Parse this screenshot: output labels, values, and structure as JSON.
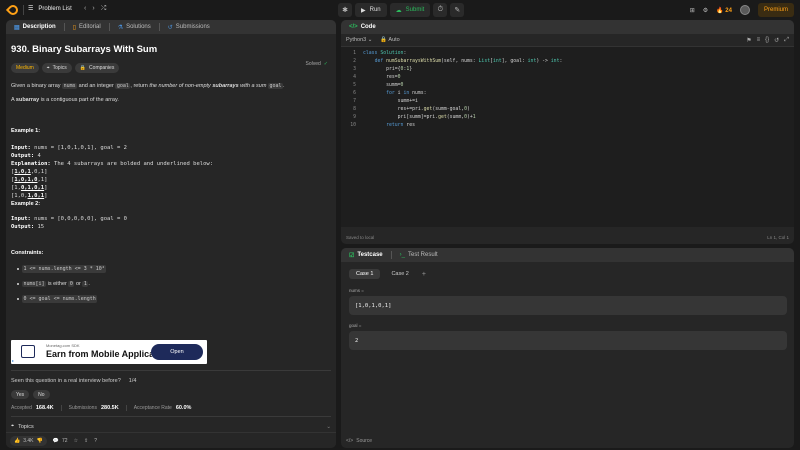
{
  "nav": {
    "problem_list": "Problem List",
    "run": "Run",
    "submit": "Submit",
    "streak": "24",
    "premium": "Premium"
  },
  "tabs": {
    "description": "Description",
    "editorial": "Editorial",
    "solutions": "Solutions",
    "submissions": "Submissions"
  },
  "problem": {
    "title": "930. Binary Subarrays With Sum",
    "solved": "Solved",
    "difficulty": "Medium",
    "topics_chip": "Topics",
    "companies_chip": "Companies",
    "stmt_a": "Given a binary array ",
    "stmt_nums": "nums",
    "stmt_b": " and an integer ",
    "stmt_goal": "goal",
    "stmt_c": ", return ",
    "stmt_d": "the number of non-empty ",
    "stmt_sub": "subarrays",
    "stmt_e": " with a sum ",
    "stmt_goal2": "goal",
    "stmt_f": ".",
    "def_a": "A ",
    "def_b": "subarray",
    "def_c": " is a contiguous part of the array.",
    "ex1_title": "Example 1:",
    "ex1_input_label": "Input:",
    "ex1_input": " nums = [1,0,1,0,1], goal = 2",
    "ex1_output_label": "Output:",
    "ex1_output": " 4",
    "ex1_expl_label": "Explanation:",
    "ex1_expl": " The 4 subarrays are bolded and underlined below:",
    "ex2_title": "Example 2:",
    "ex2_input_label": "Input:",
    "ex2_input": " nums = [0,0,0,0,0], goal = 0",
    "ex2_output_label": "Output:",
    "ex2_output": " 15",
    "constraints_title": "Constraints:",
    "c1": "1 <= nums.length <= 3 * 10⁴",
    "c2a": "nums[i]",
    "c2b": " is either ",
    "c2c": "0",
    "c2d": " or ",
    "c2e": "1",
    "c2f": ".",
    "c3": "0 <= goal <= nums.length"
  },
  "ad": {
    "small": "Monetag.com SDK",
    "title": "Earn from Mobile Application",
    "open": "Open"
  },
  "feedback": {
    "seen": "Seen this question in a real interview before?",
    "page": "1/4",
    "yes": "Yes",
    "no": "No"
  },
  "stats": {
    "accepted_label": "Accepted",
    "accepted": "168.4K",
    "submissions_label": "Submissions",
    "submissions": "280.5K",
    "rate_label": "Acceptance Rate",
    "rate": "60.0%"
  },
  "topics_section": "Topics",
  "footer": {
    "likes": "3.4K",
    "comments": "72"
  },
  "code": {
    "title": "Code",
    "language": "Python3",
    "auto": "Auto",
    "saved": "Saved to local",
    "cursor": "Ln 1, Col 1",
    "lines": [
      "1",
      "2",
      "3",
      "4",
      "5",
      "6",
      "7",
      "8",
      "9",
      "10"
    ]
  },
  "testcase": {
    "tab": "Testcase",
    "result_tab": "Test Result",
    "case1": "Case 1",
    "case2": "Case 2",
    "plus": "+",
    "nums_label": "nums =",
    "nums_value": "[1,0,1,0,1]",
    "goal_label": "goal =",
    "goal_value": "2",
    "source": "Source"
  }
}
